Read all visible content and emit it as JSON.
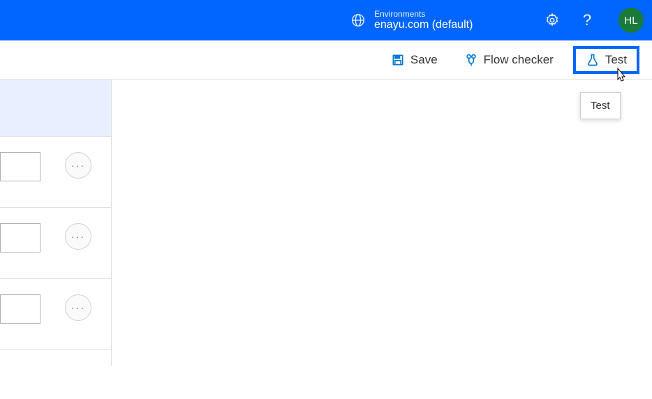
{
  "header": {
    "environments_label": "Environments",
    "environment_value": "enayu.com (default)",
    "avatar_initials": "HL"
  },
  "toolbar": {
    "save_label": "Save",
    "flow_checker_label": "Flow checker",
    "test_label": "Test"
  },
  "tooltip": {
    "text": "Test"
  }
}
